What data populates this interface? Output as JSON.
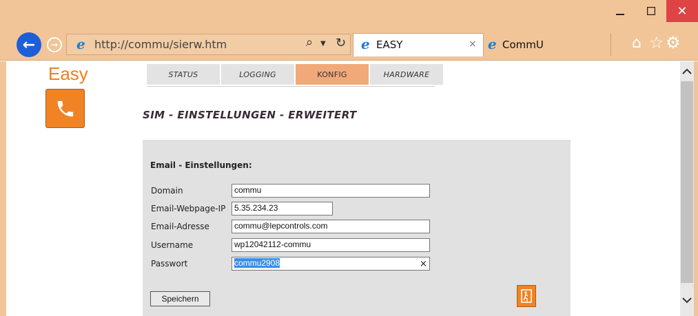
{
  "browser": {
    "address_url_host": "http://commu",
    "address_url_path": "/sierw.htm",
    "tabs": [
      {
        "title": "EASY",
        "close": "×"
      },
      {
        "title": "CommU"
      }
    ],
    "window_buttons": {
      "minimize": "—",
      "maximize": "☐",
      "close": "✕"
    },
    "theme_color": "#f1c598"
  },
  "page": {
    "brand": "Easy",
    "brand_color": "#ef7f1a",
    "nav": [
      {
        "label": "STATUS"
      },
      {
        "label": "LOGGING"
      },
      {
        "label": "KONFIG",
        "active": true
      },
      {
        "label": "HARDWARE"
      }
    ],
    "title": "SIM - EINSTELLUNGEN - ERWEITERT",
    "section_title": "Email - Einstellungen:",
    "fields": [
      {
        "label": "Domain",
        "value": "commu"
      },
      {
        "label": "Email-Webpage-IP",
        "value": "5.35.234.23"
      },
      {
        "label": "Email-Adresse",
        "value": "commu@lepcontrols.com"
      },
      {
        "label": "Username",
        "value": "wp12042112-commu"
      },
      {
        "label": "Passwort",
        "value": "commu2908"
      }
    ],
    "save_label": "Speichern",
    "clear_icon": "×",
    "accent_color": "#f08324"
  },
  "icons": {
    "back": "arrow-left-icon",
    "forward": "arrow-right-icon",
    "search": "search-icon",
    "refresh": "refresh-icon",
    "home": "home-icon",
    "favorites": "star-icon",
    "settings": "gear-icon",
    "phone": "phone-icon",
    "exit": "exit-icon"
  }
}
